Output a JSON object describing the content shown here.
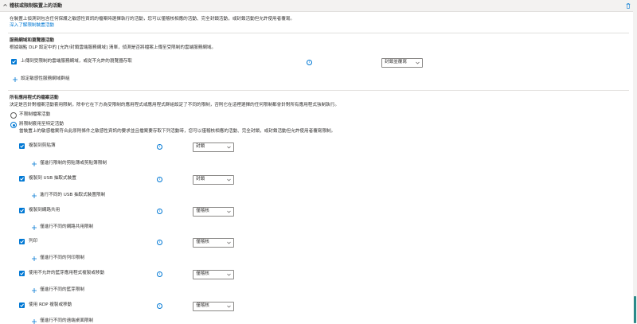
{
  "header": {
    "title": "稽核或限制裝置上的活動"
  },
  "intro": {
    "text": "在裝置上偵測到包含任何保護之敏感性資訊的檔案時選擇執行的活動，您可以僅稽核相應的活動、完全封鎖活動，或封鎖活動但允許使用者覆寫。",
    "link": "深入了解限制裝置活動"
  },
  "service_domain": {
    "title": "服務網域和瀏覽器活動",
    "desc": "根據端點 DLP 設定中的 [允許/封鎖雲端服務網域] 清單，偵測是否將檔案上傳至受限制的雲端服務網域。",
    "row_label": "上傳到受限制的雲端服務網域，或從不允許的瀏覽器存取",
    "row_value": "封鎖並覆寫",
    "add_link": "設定敏感性服務網域群組"
  },
  "app_activity": {
    "title": "所有應用程式的檔案活動",
    "desc": "決定是否針對檔案活動套用限制，除非它在下方為受限制的應用程式或應用程式群組設定了不同的限制，否則它在這裡選擇的任何限制都會針對所有應用程式強制執行。",
    "radio_off": "不限制檔案活動",
    "radio_on": "將限制套用至特定活動",
    "radio_on_desc": "當裝置上的敏感檔案符合此原則條件之敏感性資訊的要求並且檔案要存取下列活動時，您可以僅稽核相應的活動、完全封鎖，或封鎖活動但允許使用者覆寫限制。",
    "items": [
      {
        "label": "複製到剪貼簿",
        "value": "封鎖",
        "add": "僅進行限制的剪貼簿或剪貼簿限制"
      },
      {
        "label": "複製到 USB 抽取式裝置",
        "value": "封鎖",
        "add": "進行不同的 USB 抽取式裝置限制"
      },
      {
        "label": "複製到網路共用",
        "value": "僅稽核",
        "add": "僅進行不同的網路共用限制"
      },
      {
        "label": "列印",
        "value": "僅稽核",
        "add": "僅進行不同的列印限制"
      },
      {
        "label": "使用不允許的藍芽應用程式複製或移動",
        "value": "僅稽核",
        "add": "僅進行不同的藍芽限制"
      },
      {
        "label": "使用 RDP 複製或移動",
        "value": "僅稽核",
        "add": "僅進行不同的遠端桌面限制"
      }
    ]
  }
}
